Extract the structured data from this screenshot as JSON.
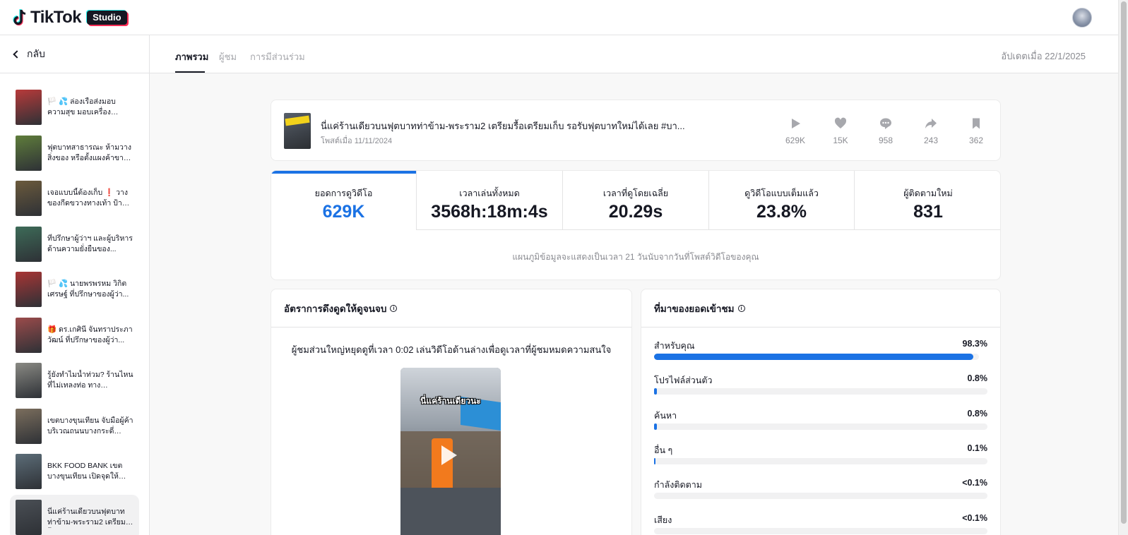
{
  "app": {
    "brand": "TikTok",
    "badge": "Studio"
  },
  "sidebar": {
    "back_label": "กลับ",
    "videos": [
      {
        "title": "🏳️ 💦 ล่องเรือส่งมอบความสุข มอบเครื่องอุปโภคบริโภค...",
        "thumb": "#b83a3a"
      },
      {
        "title": "ฟุตบาทสาธารณะ ห้ามวางสิ่งของ หรือตั้งแผงค้าขาย ...",
        "thumb": "#5f7d3b"
      },
      {
        "title": "เจอแบบนี้ต้องเก็บ ❗ วางของกีดขวางทางเท้า ป้ายไม่ได้...",
        "thumb": "#6b5a3c"
      },
      {
        "title": "ที่ปรึกษาผู้ว่าฯ และผู้บริหารด้านความยั่งยืนของ...",
        "thumb": "#3d6b58"
      },
      {
        "title": "🏳️ 💦 นายพรพรหม วิกิตเศรษฐ์ ที่ปรึกษาของผู้ว่า...",
        "thumb": "#a83535"
      },
      {
        "title": "🎁 ดร.เกศินี จันทราประภาวัฒน์ ที่ปรึกษาของผู้ว่า...",
        "thumb": "#9b4b4b"
      },
      {
        "title": "รู้ยังทำไมน้ำท่วม? ร้านไหนที่ไม่เทลงท่อ ทางสำนักงาน...",
        "thumb": "#8a8a84"
      },
      {
        "title": "เขตบางขุนเทียน จับมือผู้ค้าบริเวณถนนบางกระดี่ ร่วมใจ...",
        "thumb": "#7b6e5d"
      },
      {
        "title": "BKK FOOD BANK เขตบางขุนเทียน เปิดจุดให้บริก...",
        "thumb": "#5c6d78"
      },
      {
        "title": "นี่แค่ร้านเดียวบนฟุตบาทท่าข้าม-พระราม2 เตรียมรื้อ...",
        "thumb": "#4a4f55"
      }
    ]
  },
  "tabs": [
    {
      "label": "ภาพรวม",
      "active": true
    },
    {
      "label": "ผู้ชม",
      "active": false
    },
    {
      "label": "การมีส่วนร่วม",
      "active": false
    }
  ],
  "updated_label": "อัปเดตเมื่อ 22/1/2025",
  "post": {
    "title": "นี่แค่ร้านเดียวบนฟุตบาทท่าข้าม-พระราม2 เตรียมรื้อเตรียมเก็บ รอรับฟุตบาทใหม่ได้เลย #บา...",
    "date": "โพสต์เมื่อ 11/11/2024",
    "stats": {
      "views": "629K",
      "likes": "15K",
      "comments": "958",
      "shares": "243",
      "saves": "362"
    }
  },
  "metrics": [
    {
      "label": "ยอดการดูวิดีโอ",
      "value": "629K"
    },
    {
      "label": "เวลาเล่นทั้งหมด",
      "value": "3568h:18m:4s"
    },
    {
      "label": "เวลาที่ดูโดยเฉลี่ย",
      "value": "20.29s"
    },
    {
      "label": "ดูวิดีโอแบบเต็มแล้ว",
      "value": "23.8%"
    },
    {
      "label": "ผู้ติดตามใหม่",
      "value": "831"
    }
  ],
  "metrics_note": "แผนภูมิข้อมูลจะแสดงเป็นเวลา 21 วันนับจากวันที่โพสต์วิดีโอของคุณ",
  "retention": {
    "title": "อัตราการดึงดูดให้ดูจนจบ",
    "text": "ผู้ชมส่วนใหญ่หยุดดูที่เวลา 0:02 เล่นวิดีโอด้านล่างเพื่อดูเวลาที่ผู้ชมหมดความสนใจ",
    "video_caption": "นี่แค่ร้านเดียวนะ"
  },
  "traffic": {
    "title": "ที่มาของยอดเข้าชม",
    "sources": [
      {
        "label": "สำหรับคุณ",
        "value": "98.3%",
        "fraction": 0.983
      },
      {
        "label": "โปรไฟล์ส่วนตัว",
        "value": "0.8%",
        "fraction": 0.008
      },
      {
        "label": "ค้นหา",
        "value": "0.8%",
        "fraction": 0.008
      },
      {
        "label": "อื่น ๆ",
        "value": "0.1%",
        "fraction": 0.001
      },
      {
        "label": "กำลังติดตาม",
        "value": "<0.1%",
        "fraction": 0.0
      },
      {
        "label": "เสียง",
        "value": "<0.1%",
        "fraction": 0.0
      }
    ]
  },
  "colors": {
    "accent": "#1b72e4",
    "text": "#161823",
    "muted": "#8a8b91",
    "pink": "#fe2c55",
    "cyan": "#25f4ee"
  }
}
